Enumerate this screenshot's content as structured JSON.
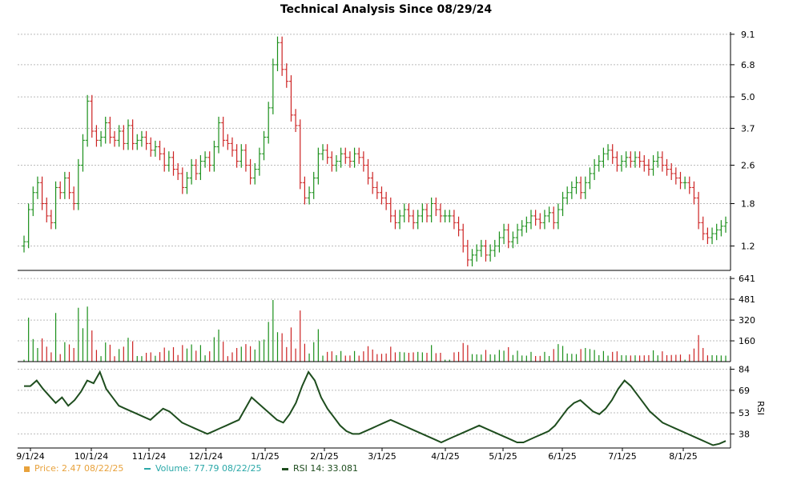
{
  "chart_data": {
    "title": "Technical Analysis Since 08/29/24",
    "type": "ohlc",
    "x_tick_labels": [
      "9/1/24",
      "10/1/24",
      "11/1/24",
      "12/1/24",
      "1/1/25",
      "2/1/25",
      "3/1/25",
      "4/1/25",
      "5/1/25",
      "6/1/25",
      "7/1/25",
      "8/1/25"
    ],
    "price_panel": {
      "scale": "log",
      "ylim": [
        0.95,
        9.3
      ],
      "ticks": [
        "9.1",
        "6.8",
        "5.0",
        "3.7",
        "2.6",
        "1.8",
        "1.2"
      ],
      "up_color": "#1a8f1a",
      "down_color": "#cc2222",
      "series": [
        {
          "month": "9/24",
          "values": [
            1.25,
            1.7,
            2.0,
            2.2,
            1.8,
            1.6,
            1.5,
            2.1,
            2.0,
            2.3,
            2.0,
            1.8
          ]
        },
        {
          "month": "10/24",
          "values": [
            2.6,
            3.3,
            4.8,
            3.6,
            3.3,
            3.4,
            3.9,
            3.4,
            3.3,
            3.6,
            3.2,
            3.8,
            3.2,
            3.3,
            3.4,
            3.2,
            3.0
          ]
        },
        {
          "month": "11/24",
          "values": [
            3.1,
            2.9,
            2.6,
            2.8,
            2.5,
            2.4,
            2.1,
            2.3,
            2.6,
            2.4,
            2.7,
            2.8,
            2.6,
            3.1,
            3.9,
            3.3,
            3.2,
            3.0,
            2.7
          ]
        },
        {
          "month": "12/24",
          "values": [
            3.0,
            2.6,
            2.3,
            2.5,
            2.9,
            3.4,
            4.5,
            6.8,
            8.4,
            6.5,
            5.8,
            4.2,
            3.8
          ]
        },
        {
          "month": "1/25",
          "values": [
            2.2,
            1.9,
            2.0,
            2.3,
            2.9,
            3.0,
            2.8,
            2.6,
            2.7,
            2.9,
            2.8,
            2.7,
            2.9,
            2.8,
            2.6,
            2.3,
            2.1,
            2.0,
            1.9,
            1.8
          ]
        },
        {
          "month": "2/25",
          "values": [
            1.6,
            1.5,
            1.6,
            1.7,
            1.6,
            1.5,
            1.6,
            1.7,
            1.6,
            1.8,
            1.7,
            1.6,
            1.6,
            1.6
          ]
        },
        {
          "month": "3/25",
          "values": [
            1.5,
            1.4,
            1.2,
            1.05,
            1.1,
            1.15,
            1.2,
            1.1,
            1.15,
            1.2,
            1.3,
            1.4,
            1.25,
            1.3,
            1.4,
            1.45,
            1.5,
            1.6,
            1.55,
            1.5,
            1.6,
            1.65
          ]
        },
        {
          "month": "5/25",
          "values": [
            1.5,
            1.7,
            1.9,
            2.0,
            2.1,
            2.2,
            2.0,
            2.2,
            2.4,
            2.6,
            2.7,
            2.9,
            3.0,
            2.8,
            2.6,
            2.7,
            2.8,
            2.7,
            2.8,
            2.7,
            2.6,
            2.5
          ]
        },
        {
          "month": "7/25",
          "values": [
            2.7,
            2.8,
            2.6,
            2.5,
            2.4,
            2.3,
            2.2,
            2.2,
            2.1,
            1.9,
            1.5,
            1.35,
            1.3,
            1.35,
            1.4,
            1.45,
            1.5
          ]
        }
      ]
    },
    "volume_panel": {
      "ticks": [
        "641",
        "481",
        "320",
        "160"
      ],
      "ylim": [
        0,
        660
      ],
      "color": "#1a8f1a",
      "down_color": "#cc2222"
    },
    "rsi_panel": {
      "ylabel": "RSI",
      "ticks": [
        "84",
        "69",
        "53",
        "38"
      ],
      "ylim": [
        28,
        86
      ],
      "color": "#1e4d1e",
      "series": [
        72,
        72,
        76,
        70,
        65,
        60,
        64,
        58,
        62,
        68,
        76,
        74,
        82,
        70,
        64,
        58,
        56,
        54,
        52,
        50,
        48,
        52,
        56,
        54,
        50,
        46,
        44,
        42,
        40,
        38,
        40,
        42,
        44,
        46,
        48,
        56,
        64,
        60,
        56,
        52,
        48,
        46,
        52,
        60,
        72,
        82,
        76,
        64,
        56,
        50,
        44,
        40,
        38,
        38,
        40,
        42,
        44,
        46,
        48,
        46,
        44,
        42,
        40,
        38,
        36,
        34,
        32,
        34,
        36,
        38,
        40,
        42,
        44,
        42,
        40,
        38,
        36,
        34,
        32,
        32,
        34,
        36,
        38,
        40,
        44,
        50,
        56,
        60,
        62,
        58,
        54,
        52,
        56,
        62,
        70,
        76,
        72,
        66,
        60,
        54,
        50,
        46,
        44,
        42,
        40,
        38,
        36,
        34,
        32,
        30,
        31,
        33
      ]
    },
    "legend": [
      {
        "label": "Price: 2.47  08/22/25",
        "color": "#e8a23c"
      },
      {
        "label": "Volume: 77.79  08/22/25",
        "color": "#2aa8a8"
      },
      {
        "label": "RSI 14: 33.081",
        "color": "#1e4d1e"
      }
    ]
  }
}
